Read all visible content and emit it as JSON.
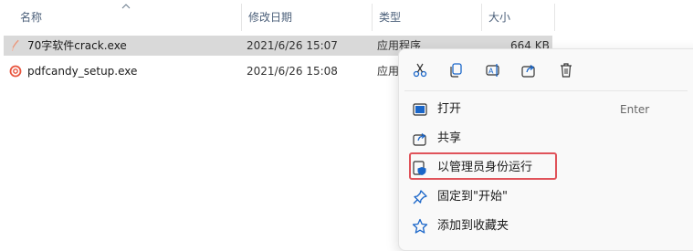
{
  "columns": {
    "name": "名称",
    "modified": "修改日期",
    "type": "类型",
    "size": "大小"
  },
  "files": [
    {
      "name": "70字软件crack.exe",
      "modified": "2021/6/26 15:07",
      "type": "应用程序",
      "size": "664 KB",
      "icon": "exe-feather-icon",
      "selected": true
    },
    {
      "name": "pdfcandy_setup.exe",
      "modified": "2021/6/26 15:08",
      "type": "应用程序",
      "icon": "pdfcandy-icon",
      "selected": false
    }
  ],
  "context_menu": {
    "toolbar": [
      "cut-icon",
      "copy-icon",
      "rename-icon",
      "share-icon",
      "delete-icon"
    ],
    "items": [
      {
        "label": "打开",
        "shortcut": "Enter",
        "icon": "open-icon"
      },
      {
        "label": "共享",
        "icon": "share-icon"
      },
      {
        "label": "以管理员身份运行",
        "icon": "shield-admin-icon",
        "highlighted": true
      },
      {
        "label": "固定到\"开始\"",
        "icon": "pin-icon"
      },
      {
        "label": "添加到收藏夹",
        "icon": "star-icon"
      }
    ]
  },
  "colors": {
    "header_text": "#4c607a",
    "selection": "#d9d9d9",
    "icon_blue": "#1a66c9",
    "highlight_border": "#e0535a"
  }
}
